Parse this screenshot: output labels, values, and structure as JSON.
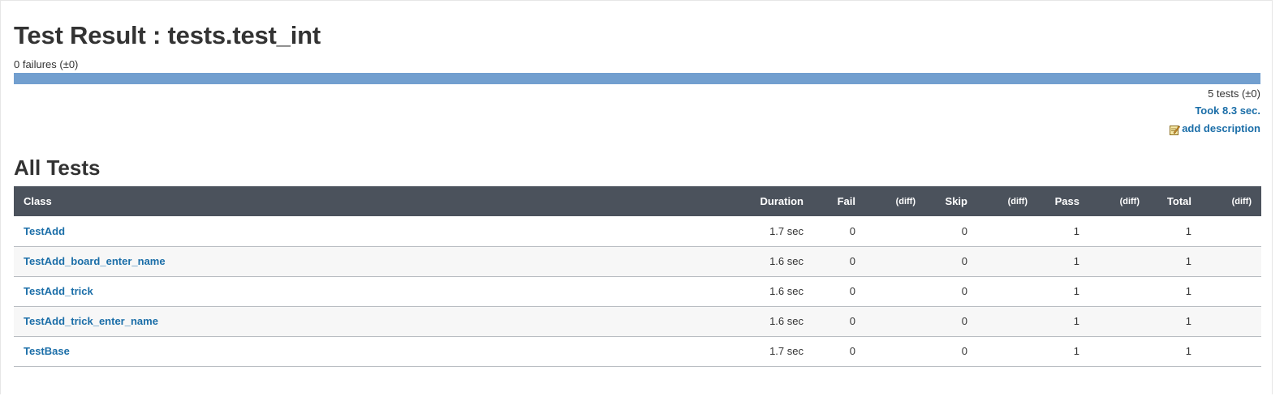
{
  "page": {
    "title": "Test Result : tests.test_int",
    "failures": "0 failures (±0)",
    "progress_pass_fraction": 1.0,
    "tests_count": "5 tests (±0)",
    "took": "Took 8.3 sec.",
    "add_description": "add description",
    "section_title": "All Tests"
  },
  "colors": {
    "progress": "#729fcf",
    "header_bg": "#4b525c",
    "link": "#1b6ea8"
  },
  "table": {
    "headers": {
      "class": "Class",
      "duration": "Duration",
      "fail": "Fail",
      "fail_diff": "(diff)",
      "skip": "Skip",
      "skip_diff": "(diff)",
      "pass": "Pass",
      "pass_diff": "(diff)",
      "total": "Total",
      "total_diff": "(diff)"
    },
    "rows": [
      {
        "class": "TestAdd",
        "duration": "1.7 sec",
        "fail": "0",
        "skip": "0",
        "pass": "1",
        "total": "1"
      },
      {
        "class": "TestAdd_board_enter_name",
        "duration": "1.6 sec",
        "fail": "0",
        "skip": "0",
        "pass": "1",
        "total": "1"
      },
      {
        "class": "TestAdd_trick",
        "duration": "1.6 sec",
        "fail": "0",
        "skip": "0",
        "pass": "1",
        "total": "1"
      },
      {
        "class": "TestAdd_trick_enter_name",
        "duration": "1.6 sec",
        "fail": "0",
        "skip": "0",
        "pass": "1",
        "total": "1"
      },
      {
        "class": "TestBase",
        "duration": "1.7 sec",
        "fail": "0",
        "skip": "0",
        "pass": "1",
        "total": "1"
      }
    ]
  }
}
